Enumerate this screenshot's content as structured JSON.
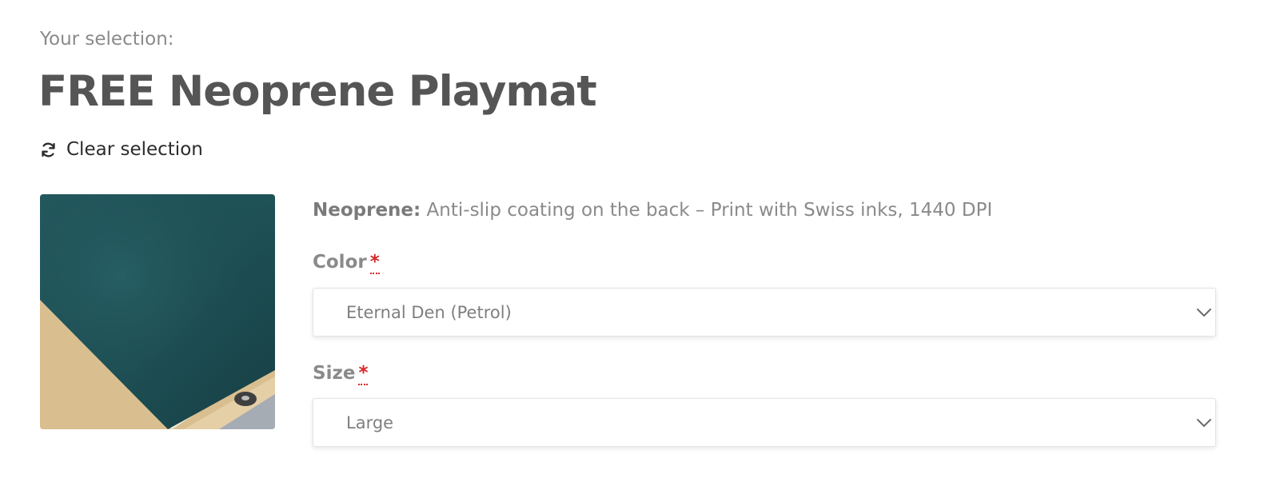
{
  "header": {
    "selection_label": "Your selection:",
    "product_title": "FREE Neoprene Playmat",
    "clear_selection_label": "Clear selection"
  },
  "description": {
    "material_key": "Neoprene:",
    "material_text": " Anti-slip coating on the back – Print with Swiss inks, 1440 DPI"
  },
  "fields": {
    "color": {
      "label": "Color",
      "required_mark": "*",
      "selected_value": "Eternal Den (Petrol)"
    },
    "size": {
      "label": "Size",
      "required_mark": "*",
      "selected_value": "Large"
    }
  },
  "colors": {
    "mat_petrol": "#1e5258",
    "required_red": "#d62828",
    "title_gray": "#555555"
  },
  "icons": {
    "clear": "refresh-icon",
    "dropdown": "chevron-down-icon"
  }
}
